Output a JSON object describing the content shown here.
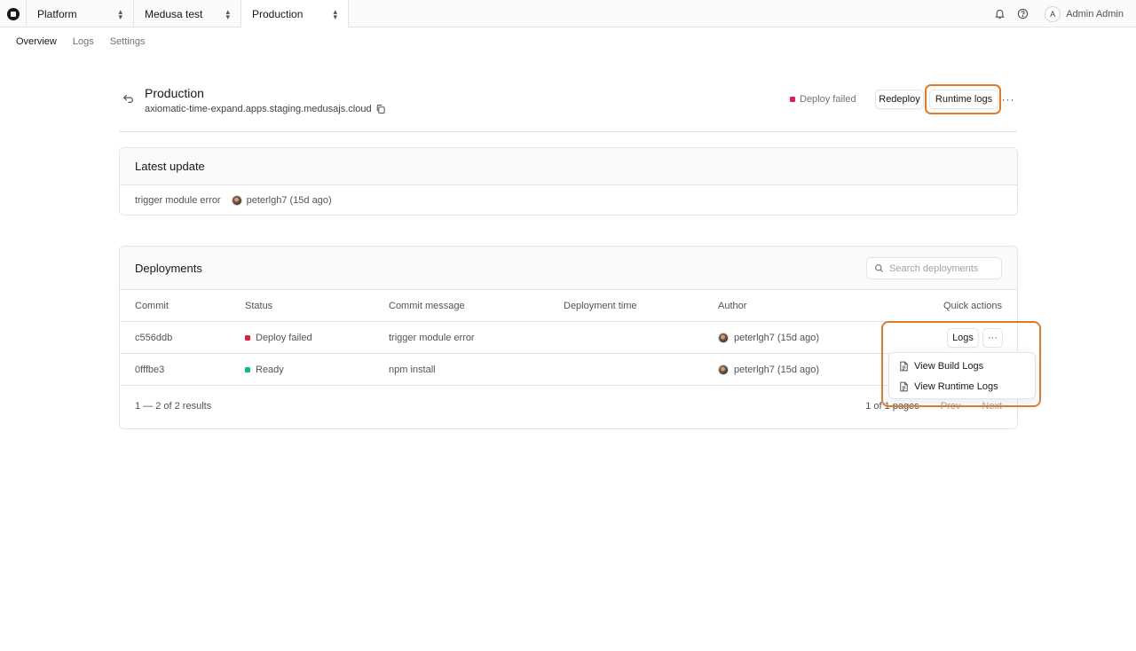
{
  "topbar": {
    "switchers": [
      {
        "label": "Platform"
      },
      {
        "label": "Medusa test"
      },
      {
        "label": "Production"
      }
    ],
    "user": {
      "initial": "A",
      "name": "Admin Admin"
    }
  },
  "subnav": {
    "items": [
      {
        "label": "Overview"
      },
      {
        "label": "Logs"
      },
      {
        "label": "Settings"
      }
    ]
  },
  "header": {
    "title": "Production",
    "url": "axiomatic-time-expand.apps.staging.medusajs.cloud",
    "status": "Deploy failed",
    "redeploy_label": "Redeploy",
    "runtime_logs_label": "Runtime logs",
    "more_label": "···"
  },
  "latest_update": {
    "title": "Latest update",
    "message": "trigger module error",
    "author": "peterlgh7 (15d ago)"
  },
  "deployments": {
    "title": "Deployments",
    "search_placeholder": "Search deployments",
    "columns": {
      "commit": "Commit",
      "status": "Status",
      "message": "Commit message",
      "time": "Deployment time",
      "author": "Author",
      "quick": "Quick actions"
    },
    "rows": [
      {
        "commit": "c556ddb",
        "status": "Deploy failed",
        "message": "trigger module error",
        "time": "",
        "author": "peterlgh7 (15d ago)"
      },
      {
        "commit": "0fffbe3",
        "status": "Ready",
        "message": "npm install",
        "time": "",
        "author": "peterlgh7 (15d ago)"
      }
    ],
    "logs_label": "Logs",
    "more_label": "···",
    "results": "1 — 2 of 2 results",
    "pages": "1 of 1 pages",
    "prev": "Prev",
    "next": "Next"
  },
  "dropdown": {
    "items": [
      {
        "label": "View Build Logs"
      },
      {
        "label": "View Runtime Logs"
      }
    ]
  },
  "colors": {
    "failed": "#e11d48",
    "ready": "#10b981",
    "highlight": "#e07b28"
  }
}
